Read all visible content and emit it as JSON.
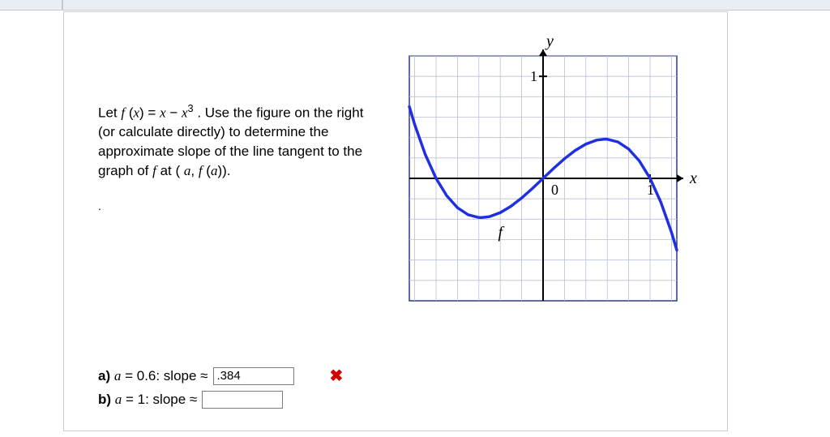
{
  "problem": {
    "text_html": "Let <span class='ital'>f</span> (<span class='ital'>x</span>) = <span class='ital'>x</span> − <span class='ital'>x</span><sup>3</sup> . Use the figure on the right (or calculate directly) to determine the approximate slope of the line tangent to the graph of <span class='ital'>f</span> at ( <span class='ital'>a</span>, <span class='ital'>f</span> (<span class='ital'>a</span>))."
  },
  "answers": {
    "a": {
      "label_html": "<b>a)</b> <span class='ital'>a</span> = 0.6: slope ≈",
      "value": ".384",
      "status": "incorrect"
    },
    "b": {
      "label_html": "<b>b)</b> <span class='ital'>a</span> = 1: slope ≈",
      "value": "",
      "status": "pending"
    }
  },
  "graph": {
    "y_label": "y",
    "x_label": "x",
    "origin_label": "0",
    "x_tick_label": "1",
    "y_tick_label": "1",
    "curve_label": "f"
  },
  "chart_data": {
    "type": "line",
    "title": "",
    "xlabel": "x",
    "ylabel": "y",
    "xlim": [
      -1.25,
      1.25
    ],
    "ylim": [
      -1.2,
      1.2
    ],
    "grid_step": 0.2,
    "series": [
      {
        "name": "f",
        "formula": "x - x^3",
        "x": [
          -1.25,
          -1.2,
          -1.1,
          -1.0,
          -0.9,
          -0.8,
          -0.7,
          -0.6,
          -0.577,
          -0.5,
          -0.4,
          -0.3,
          -0.2,
          -0.1,
          0.0,
          0.1,
          0.2,
          0.3,
          0.4,
          0.5,
          0.577,
          0.6,
          0.7,
          0.8,
          0.9,
          1.0,
          1.1,
          1.2,
          1.25
        ],
        "y": [
          0.703,
          0.528,
          0.231,
          0.0,
          -0.171,
          -0.288,
          -0.357,
          -0.384,
          -0.385,
          -0.375,
          -0.336,
          -0.273,
          -0.192,
          -0.099,
          0.0,
          0.099,
          0.192,
          0.273,
          0.336,
          0.375,
          0.385,
          0.384,
          0.357,
          0.288,
          0.171,
          0.0,
          -0.231,
          -0.528,
          -0.703
        ]
      }
    ]
  }
}
